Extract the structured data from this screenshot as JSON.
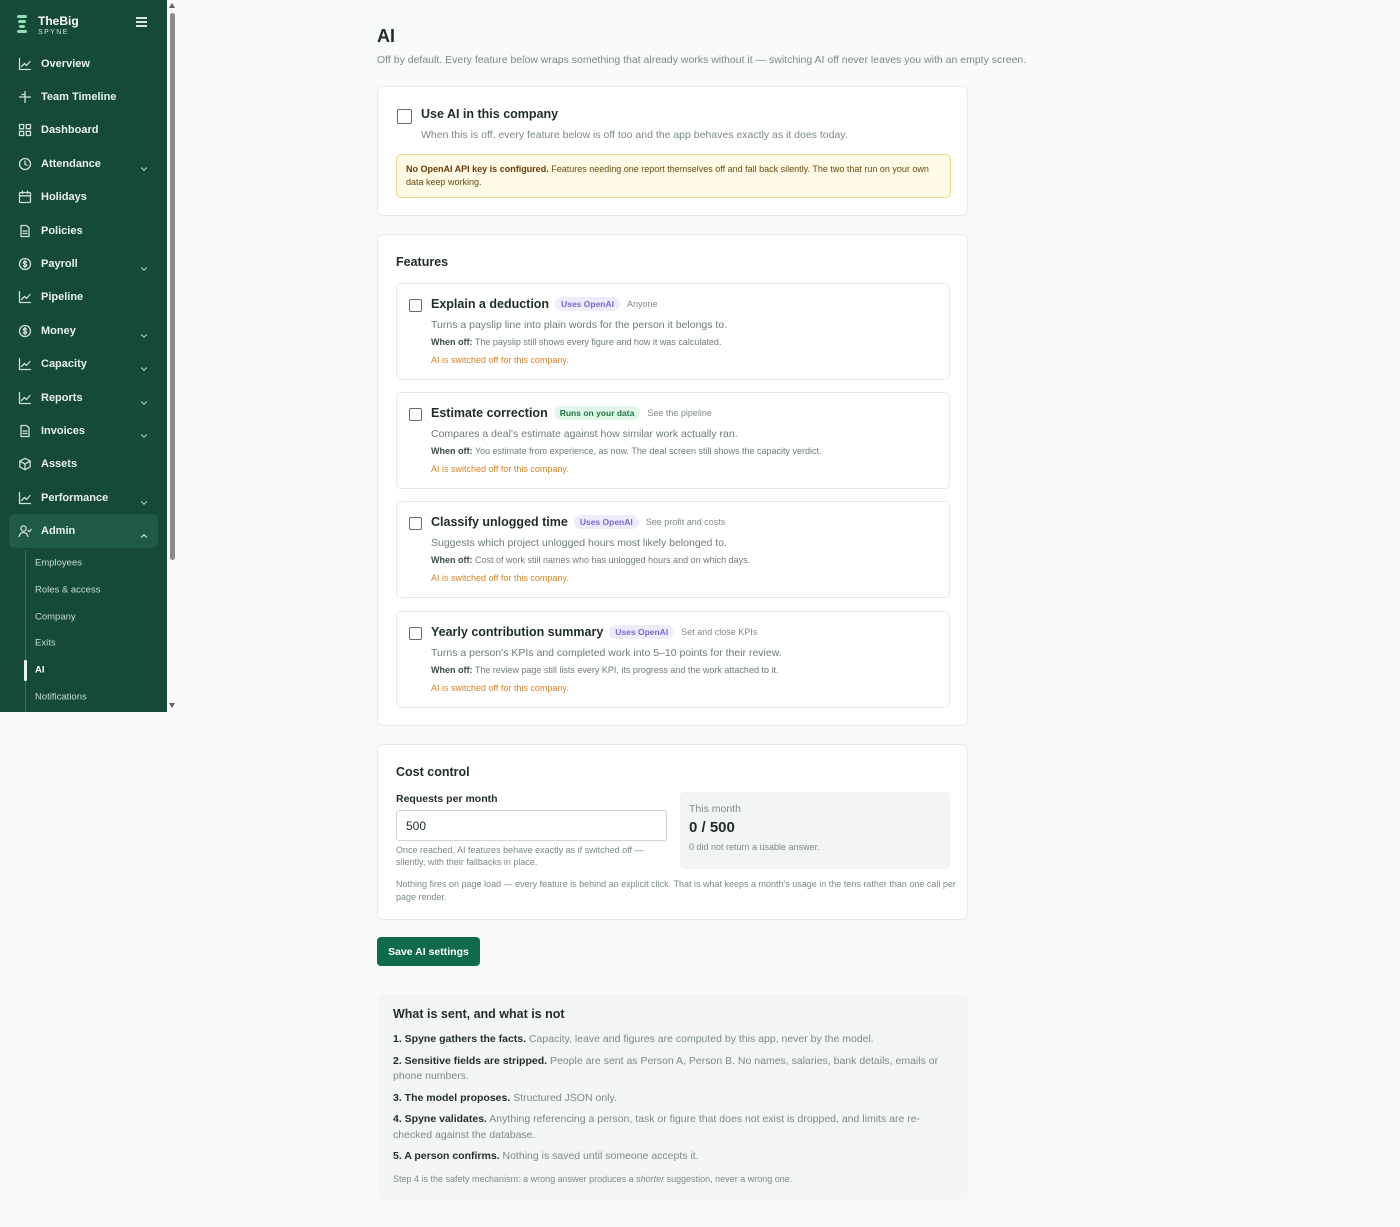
{
  "brand": {
    "name": "TheBig",
    "sub": "SPYNE"
  },
  "nav": [
    {
      "label": "Overview",
      "icon": "chart-line-icon",
      "chevron": false
    },
    {
      "label": "Team Timeline",
      "icon": "timeline-icon",
      "chevron": false
    },
    {
      "label": "Dashboard",
      "icon": "grid-icon",
      "chevron": false
    },
    {
      "label": "Attendance",
      "icon": "clock-icon",
      "chevron": true
    },
    {
      "label": "Holidays",
      "icon": "calendar-icon",
      "chevron": false
    },
    {
      "label": "Policies",
      "icon": "document-icon",
      "chevron": false
    },
    {
      "label": "Payroll",
      "icon": "coin-icon",
      "chevron": true
    },
    {
      "label": "Pipeline",
      "icon": "chart-line-icon",
      "chevron": false
    },
    {
      "label": "Money",
      "icon": "coin-icon",
      "chevron": true
    },
    {
      "label": "Capacity",
      "icon": "chart-line-icon",
      "chevron": true
    },
    {
      "label": "Reports",
      "icon": "chart-line-icon",
      "chevron": true
    },
    {
      "label": "Invoices",
      "icon": "document-icon",
      "chevron": true
    },
    {
      "label": "Assets",
      "icon": "box-icon",
      "chevron": false
    },
    {
      "label": "Performance",
      "icon": "chart-line-icon",
      "chevron": true
    },
    {
      "label": "Admin",
      "icon": "user-icon",
      "chevron": true
    }
  ],
  "admin_subnav": [
    "Employees",
    "Roles & access",
    "Company",
    "Exits",
    "AI",
    "Notifications"
  ],
  "page": {
    "title": "AI",
    "subtitle": "Off by default. Every feature below wraps something that already works without it — switching AI off never leaves you with an empty screen."
  },
  "master": {
    "title": "Use AI in this company",
    "desc": "When this is off, every feature below is off too and the app behaves exactly as it does today.",
    "warning_bold": "No OpenAI API key is configured.",
    "warning_text": " Features needing one report themselves off and fall back silently. The two that run on your own data keep working."
  },
  "features_title": "Features",
  "features": [
    {
      "title": "Explain a deduction",
      "badge": "Uses OpenAI",
      "badge_type": "openai",
      "audience": "Anyone",
      "desc": "Turns a payslip line into plain words for the person it belongs to.",
      "when_off_label": "When off:",
      "when_off": " The payslip still shows every figure and how it was calculated.",
      "note": "AI is switched off for this company."
    },
    {
      "title": "Estimate correction",
      "badge": "Runs on your data",
      "badge_type": "data",
      "audience": "See the pipeline",
      "desc": "Compares a deal's estimate against how similar work actually ran.",
      "when_off_label": "When off:",
      "when_off": " You estimate from experience, as now. The deal screen still shows the capacity verdict.",
      "note": "AI is switched off for this company."
    },
    {
      "title": "Classify unlogged time",
      "badge": "Uses OpenAI",
      "badge_type": "openai",
      "audience": "See profit and costs",
      "desc": "Suggests which project unlogged hours most likely belonged to.",
      "when_off_label": "When off:",
      "when_off": " Cost of work still names who has unlogged hours and on which days.",
      "note": "AI is switched off for this company."
    },
    {
      "title": "Yearly contribution summary",
      "badge": "Uses OpenAI",
      "badge_type": "openai",
      "audience": "Set and close KPIs",
      "desc": "Turns a person's KPIs and completed work into 5–10 points for their review.",
      "when_off_label": "When off:",
      "when_off": " The review page still lists every KPI, its progress and the work attached to it.",
      "note": "AI is switched off for this company."
    }
  ],
  "cost": {
    "title": "Cost control",
    "label": "Requests per month",
    "value": "500",
    "help": "Once reached, AI features behave exactly as if switched off — silently, with their fallbacks in place.",
    "month_label": "This month",
    "month_value": "0 / 500",
    "month_note": "0 did not return a usable answer.",
    "footer": "Nothing fires on page load — every feature is behind an explicit click. That is what keeps a month's usage in the tens rather than one call per page render."
  },
  "save_label": "Save AI settings",
  "info": {
    "title": "What is sent, and what is not",
    "items": [
      {
        "bold": "1. Spyne gathers the facts.",
        "text": " Capacity, leave and figures are computed by this app, never by the model."
      },
      {
        "bold": "2. Sensitive fields are stripped.",
        "text": " People are sent as Person A, Person B. No names, salaries, bank details, emails or phone numbers."
      },
      {
        "bold": "3. The model proposes.",
        "text": " Structured JSON only."
      },
      {
        "bold": "4. Spyne validates.",
        "text": " Anything referencing a person, task or figure that does not exist is dropped, and limits are re-checked against the database."
      },
      {
        "bold": "5. A person confirms.",
        "text": " Nothing is saved until someone accepts it."
      }
    ],
    "footer_pre": "Step 4 is the safety mechanism: a wrong answer produces a ",
    "footer_em": "shorter",
    "footer_post": " suggestion, never a wrong one."
  },
  "colors": {
    "sidebar": "#15493a",
    "primary": "#0f6b4c",
    "warning_bg": "#fff9e6",
    "note": "#d98324"
  }
}
